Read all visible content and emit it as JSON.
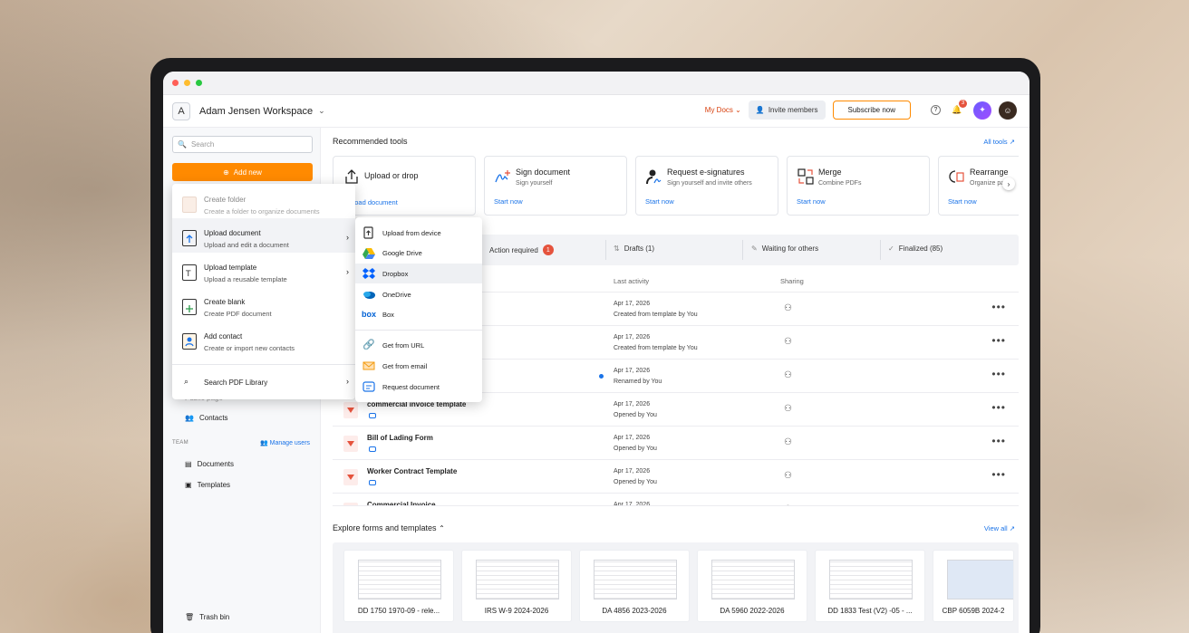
{
  "workspace": {
    "avatar": "A",
    "name": "Adam Jensen Workspace"
  },
  "topbar": {
    "my_docs": "My Docs",
    "invite": "Invite members",
    "subscribe": "Subscribe now",
    "notif_count": "3"
  },
  "sidebar": {
    "search_placeholder": "Search",
    "add_new": "Add new",
    "partial_item": "Public page",
    "contacts": "Contacts",
    "team_label": "TEAM",
    "manage_users": "Manage users",
    "documents": "Documents",
    "templates": "Templates",
    "trash": "Trash bin"
  },
  "recommended": {
    "title": "Recommended tools",
    "all_tools": "All tools",
    "tools": [
      {
        "title": "Upload or drop",
        "sub": "",
        "action": "Upload document"
      },
      {
        "title": "Sign document",
        "sub": "Sign yourself",
        "action": "Start now"
      },
      {
        "title": "Request e-signatures",
        "sub": "Sign yourself and invite others",
        "action": "Start now"
      },
      {
        "title": "Merge",
        "sub": "Combine PDFs",
        "action": "Start now"
      },
      {
        "title": "Rearrange",
        "sub": "Organize pages",
        "action": "Start now"
      }
    ]
  },
  "tabs": {
    "action_required": "Action required",
    "action_count": "1",
    "drafts": "Drafts (1)",
    "waiting": "Waiting for others",
    "finalized": "Finalized (85)"
  },
  "columns": {
    "last_activity": "Last activity",
    "sharing": "Sharing"
  },
  "rows": [
    {
      "name": "",
      "date": "Apr 17, 2026",
      "activity": "Created from template by You"
    },
    {
      "name": "",
      "date": "Apr 17, 2026",
      "activity": "Created from template by You"
    },
    {
      "name": "",
      "date": "Apr 17, 2026",
      "activity": "Renamed by You"
    },
    {
      "name": "commercial invoice template",
      "date": "Apr 17, 2026",
      "activity": "Opened by You"
    },
    {
      "name": "Bill of Lading Form",
      "date": "Apr 17, 2026",
      "activity": "Opened by You"
    },
    {
      "name": "Worker Contract Template",
      "date": "Apr 17, 2026",
      "activity": "Opened by You"
    },
    {
      "name": "Commercial Invoice",
      "date": "Apr 17, 2026",
      "activity": ""
    }
  ],
  "explore": {
    "title": "Explore forms and templates",
    "view_all": "View all",
    "forms": [
      "DD 1750 1970-09 - rele...",
      "IRS W-9 2024-2026",
      "DA 4856 2023-2026",
      "DA 5960 2022-2026",
      "DD 1833 Test (V2) -05 - ...",
      "CBP 6059B 2024-2"
    ]
  },
  "add_menu": {
    "items": [
      {
        "title": "Create folder",
        "sub": "Create a folder to organize documents"
      },
      {
        "title": "Upload document",
        "sub": "Upload and edit a document"
      },
      {
        "title": "Upload template",
        "sub": "Upload a reusable template"
      },
      {
        "title": "Create blank",
        "sub": "Create PDF document"
      },
      {
        "title": "Add contact",
        "sub": "Create or import new contacts"
      }
    ],
    "search_library": "Search PDF Library"
  },
  "upload_menu": [
    "Upload from device",
    "Google Drive",
    "Dropbox",
    "OneDrive",
    "Box",
    "Get from URL",
    "Get from email",
    "Request document"
  ],
  "colors": {
    "accent": "#ff8a00",
    "link": "#1a73e8",
    "badge": "#e5533d"
  }
}
